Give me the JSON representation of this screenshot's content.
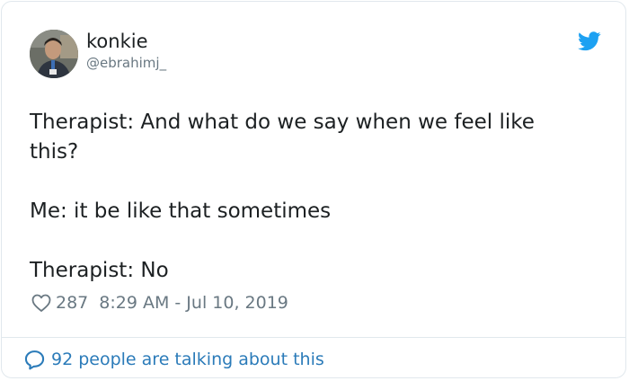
{
  "user": {
    "display_name": "konkie",
    "handle": "@ebrahimj_"
  },
  "tweet": {
    "paragraphs": [
      "Therapist: And what do we say when we feel like this?",
      "Me: it be like that sometimes",
      "Therapist: No"
    ],
    "like_count": "287",
    "timestamp": "8:29 AM - Jul 10, 2019"
  },
  "footer": {
    "talking_text": "92 people are talking about this"
  },
  "icons": {
    "logo": "twitter-bird-icon",
    "like": "heart-outline-icon",
    "reply": "speech-bubble-icon"
  },
  "colors": {
    "brand": "#1da1f2",
    "link": "#2b7bb9",
    "muted": "#697882",
    "text": "#1c2022",
    "border": "#e1e8ed"
  }
}
